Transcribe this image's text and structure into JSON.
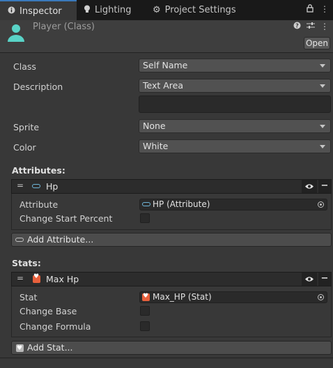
{
  "tabs": [
    {
      "label": "Inspector",
      "icon": "info-icon",
      "active": true
    },
    {
      "label": "Lighting",
      "icon": "bulb-icon",
      "active": false
    },
    {
      "label": "Project Settings",
      "icon": "gear-icon",
      "active": false
    }
  ],
  "header": {
    "title": "Player (Class)",
    "open_label": "Open"
  },
  "fields": {
    "class": {
      "label": "Class",
      "value": "Self Name"
    },
    "description": {
      "label": "Description",
      "value": "Text Area",
      "text": ""
    },
    "sprite": {
      "label": "Sprite",
      "value": "None"
    },
    "color": {
      "label": "Color",
      "value": "White"
    }
  },
  "attributes": {
    "title": "Attributes:",
    "items": [
      {
        "name": "Hp",
        "attribute_label": "Attribute",
        "attribute_value": "HP (Attribute)",
        "change_label": "Change Start Percent",
        "change_checked": false
      }
    ],
    "add_label": "Add Attribute..."
  },
  "stats": {
    "title": "Stats:",
    "items": [
      {
        "name": "Max Hp",
        "stat_label": "Stat",
        "stat_value": "Max_HP (Stat)",
        "change_base_label": "Change Base",
        "change_formula_label": "Change Formula"
      }
    ],
    "add_label": "Add Stat..."
  },
  "colors": {
    "accent": "#3a79bb",
    "attribute_icon": "#6fb6d9",
    "stat_icon": "#e8603c"
  }
}
